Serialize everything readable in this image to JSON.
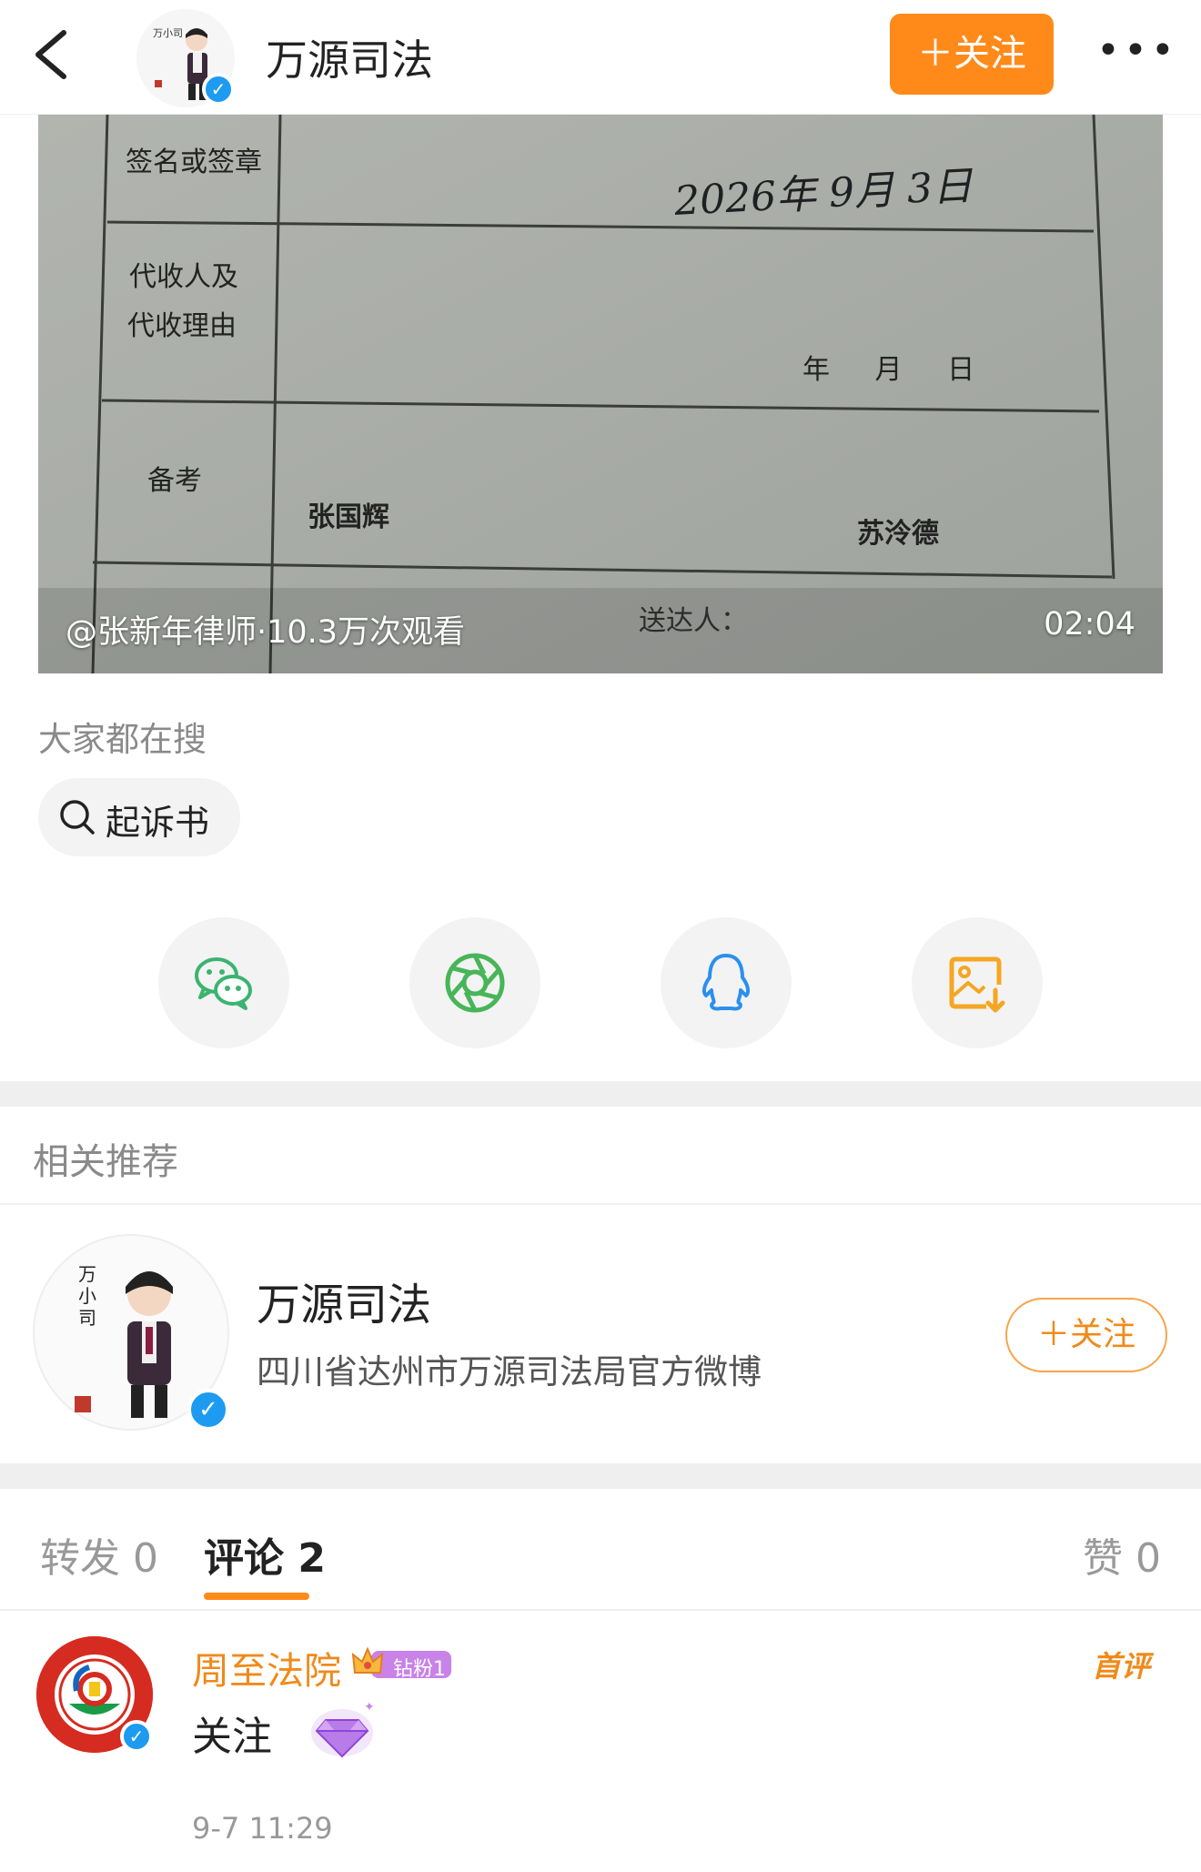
{
  "header": {
    "back_icon": "chevron-left-icon",
    "title": "万源司法",
    "avatar_text": "万小司",
    "follow_label": "＋关注",
    "more_label": "•••"
  },
  "video": {
    "caption": "@张新年律师·10.3万次观看",
    "duration": "02:04",
    "form": {
      "row1_label": "签名或签章",
      "row2_label_line1": "代收人及",
      "row2_label_line2": "代收理由",
      "row3_label": "备考",
      "handwritten_date": "2026年 9月 3日",
      "blank_date": "年 月 日",
      "name_left": "张国辉",
      "name_right": "苏泠德",
      "sender_label": "送达人："
    }
  },
  "hot_search": {
    "label": "大家都在搜",
    "chip": "起诉书"
  },
  "share_icons": [
    "wechat-icon",
    "moments-icon",
    "qq-icon",
    "save-image-icon"
  ],
  "recommend": {
    "section_title": "相关推荐",
    "name": "万源司法",
    "description": "四川省达州市万源司法局官方微博",
    "follow_label": "＋关注"
  },
  "tabs": {
    "repost": "转发 0",
    "comments": "评论 2",
    "likes": "赞 0"
  },
  "comment": {
    "author": "周至法院",
    "fan_badge": "钻粉1",
    "first_tag": "首评",
    "text": "关注",
    "time": "9-7 11:29"
  },
  "colors": {
    "accent": "#ff8a1a",
    "verified": "#1d9bf0",
    "wechat": "#3cb371",
    "qq": "#2b8ff0",
    "save": "#f5a623"
  }
}
